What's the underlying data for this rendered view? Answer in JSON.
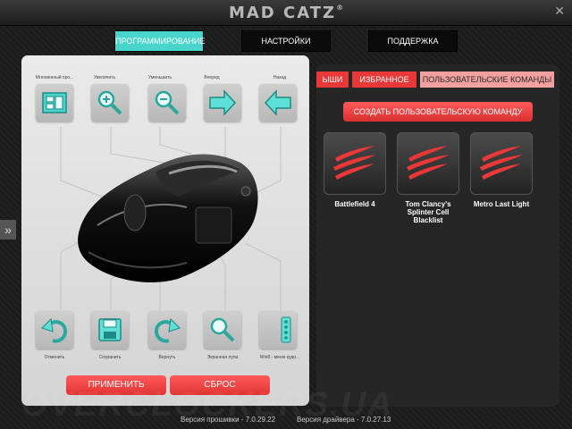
{
  "brand": {
    "name": "MAD CATZ",
    "mark": "®"
  },
  "window": {
    "close_label": "✕"
  },
  "nav": {
    "programming": "ПРОГРАММИРОВАНИЕ",
    "settings": "НАСТРОЙКИ",
    "support": "ПОДДЕРЖКА"
  },
  "left": {
    "top_buttons": [
      {
        "label": "Мгновенный про...",
        "icon": "layout-icon"
      },
      {
        "label": "Увеличить",
        "icon": "zoom-in-icon"
      },
      {
        "label": "Уменьшить",
        "icon": "zoom-out-icon"
      },
      {
        "label": "Вперед",
        "icon": "arrow-right-icon"
      },
      {
        "label": "Назад",
        "icon": "arrow-left-icon"
      }
    ],
    "bottom_buttons": [
      {
        "label": "Отменить",
        "icon": "undo-icon"
      },
      {
        "label": "Сохранить",
        "icon": "save-icon"
      },
      {
        "label": "Вернуть",
        "icon": "redo-icon"
      },
      {
        "label": "Экранная лупа",
        "icon": "magnifier-icon"
      },
      {
        "label": "Win8 - меню кудо...",
        "icon": "win8-menu-icon"
      }
    ],
    "apply_label": "ПРИМЕНИТЬ",
    "reset_label": "СБРОС"
  },
  "right": {
    "tabs": [
      "ЫШИ",
      "ИЗБРАННОЕ",
      "ПОЛЬЗОВАТЕЛЬСКИЕ КОМАНДЫ"
    ],
    "create_label": "СОЗДАТЬ ПОЛЬЗОВАТЕЛЬСКУЮ КОМАНДУ",
    "games": [
      {
        "name": "Battlefield 4"
      },
      {
        "name": "Tom Clancy's Splinter Cell Blacklist"
      },
      {
        "name": "Metro Last Light"
      }
    ]
  },
  "side_toggle": "»",
  "watermark": "OVERCLOCKERS.UA",
  "footer": {
    "firmware": "Версия прошивки - 7.0.29.22",
    "driver": "Версия драйвера - 7.0.27.13"
  },
  "colors": {
    "accent": "#49d5cb",
    "red": "#e83838",
    "panel": "#262626"
  }
}
